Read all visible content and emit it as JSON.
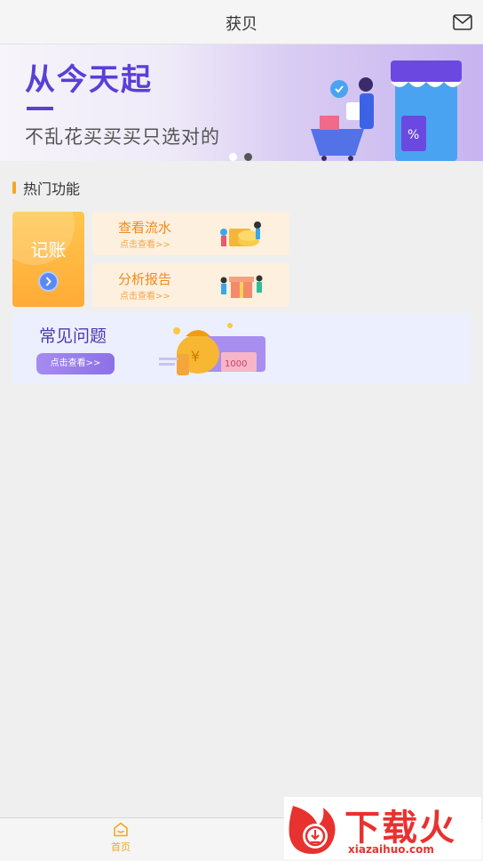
{
  "header": {
    "title": "获贝",
    "mail_icon": "mail-icon"
  },
  "banner": {
    "headline": "从今天起",
    "subline": "不乱花买买买只选对的",
    "colors": {
      "accent": "#5b3fd6"
    }
  },
  "hot": {
    "section_title": "热门功能",
    "bookkeeping": {
      "label": "记账",
      "icon": "chevron-right-icon"
    },
    "flow": {
      "title": "查看流水",
      "sub": "点击查看>>"
    },
    "report": {
      "title": "分析报告",
      "sub": "点击查看>>"
    },
    "faq": {
      "title": "常见问题",
      "button": "点击查看>>"
    }
  },
  "tabbar": {
    "home_label": "首页",
    "home_icon": "home-icon",
    "active_color": "#f5a623"
  },
  "watermark": {
    "brand": "下载火",
    "url": "xiazaihuo.com"
  }
}
